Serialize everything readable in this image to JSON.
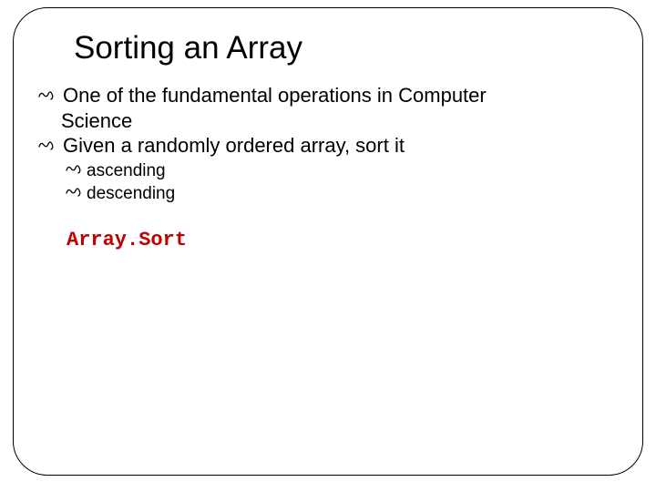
{
  "slide": {
    "title": "Sorting an Array",
    "items": [
      {
        "level": 1,
        "text": "One of the fundamental operations in Computer",
        "cont": "Science"
      },
      {
        "level": 1,
        "text": "Given a randomly ordered array, sort it"
      },
      {
        "level": 2,
        "text": "ascending"
      },
      {
        "level": 2,
        "text": "descending"
      }
    ],
    "code": "Array.Sort",
    "bullet_glyph": "ﾌ"
  }
}
